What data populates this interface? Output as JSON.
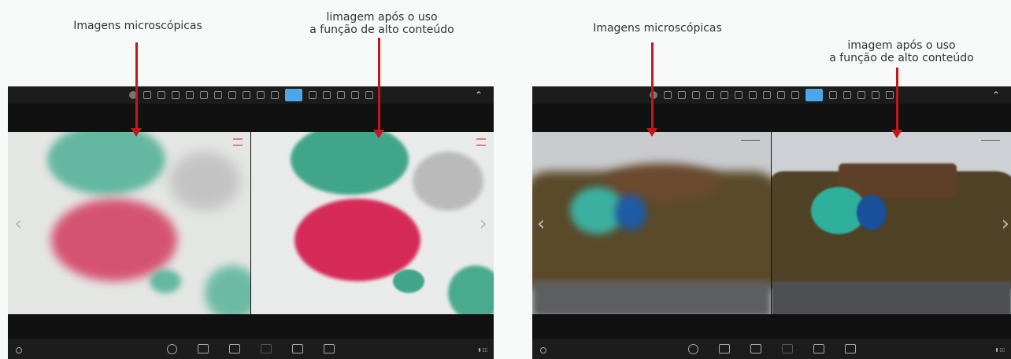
{
  "captions": {
    "left_raw": "Imagens microscópicas",
    "left_hc_line1": "limagem após o uso",
    "left_hc_line2": "a função de alto conteúdo",
    "right_raw": "Imagens microscópicas",
    "right_hc_line1": "imagem após o uso",
    "right_hc_line2": "a função de alto conteúdo"
  },
  "nav": {
    "prev": "‹",
    "next": "›"
  },
  "toolbar": {
    "collapse": "⌃"
  },
  "colors": {
    "arrow": "#c0191d",
    "toolbar_bg": "#1c1c1c",
    "active_tool": "#4aa8e8",
    "stain_green": "#3aa88a",
    "stain_red": "#d0234d",
    "rock_brown": "#5a4a2a"
  }
}
